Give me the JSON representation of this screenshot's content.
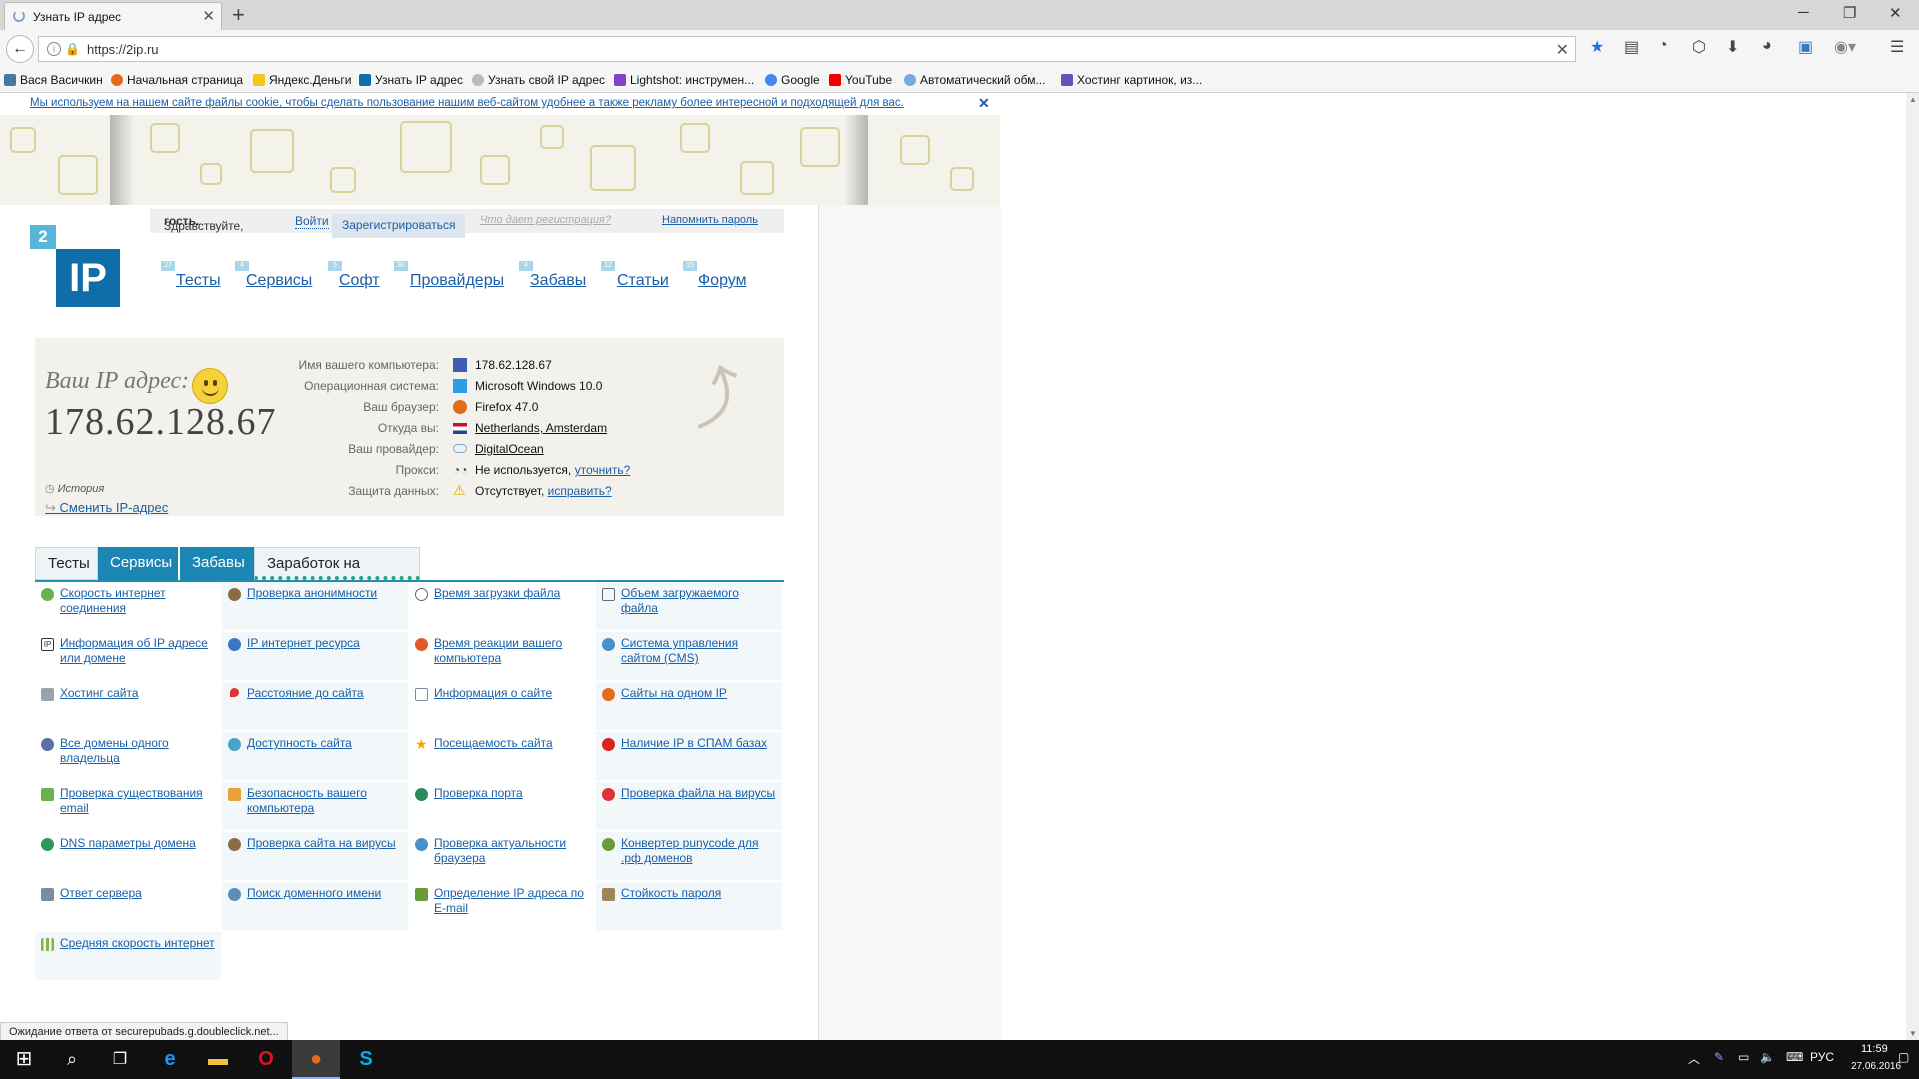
{
  "browser": {
    "tab_title": "Узнать IP адрес",
    "url": "https://2ip.ru",
    "bookmarks": [
      "Вася Васичкин",
      "Начальная страница",
      "Яндекс.Деньги",
      "Узнать IP адрес",
      "Узнать свой IP адрес",
      "Lightshot: инструмен...",
      "Google",
      "YouTube",
      "Автоматический обм...",
      "Хостинг картинок, из..."
    ],
    "status_text": "Ожидание ответа от securepubads.g.doubleclick.net..."
  },
  "cookie_notice": "Мы используем на нашем сайте файлы cookie, чтобы сделать пользование нашим веб-сайтом удобнее а также рекламу более интересной и подходящей для вас.",
  "login": {
    "greeting": "Здравствуйте, ",
    "user": "гость.",
    "login": "Войти",
    "register": "Зарегистрироваться",
    "why_register": "Что дает регистрация?",
    "forgot": "Напомнить пароль"
  },
  "logo": {
    "top": "2",
    "main": "IP"
  },
  "menu": [
    {
      "label": "Тесты",
      "badge": "27"
    },
    {
      "label": "Сервисы",
      "badge": "4"
    },
    {
      "label": "Софт",
      "badge": "5"
    },
    {
      "label": "Провайдеры",
      "badge": "3К"
    },
    {
      "label": "Забавы",
      "badge": "4"
    },
    {
      "label": "Статьи",
      "badge": "12"
    },
    {
      "label": "Форум",
      "badge": "15"
    }
  ],
  "ipinfo": {
    "title": "Ваш IP адрес:",
    "ip": "178.62.128.67",
    "history": "История",
    "change_ip": "Сменить IP-адрес",
    "rows": [
      {
        "label": "Имя вашего компьютера:",
        "value": "178.62.128.67",
        "link": false,
        "icon": "computer-icon",
        "color": "#3a5fb0"
      },
      {
        "label": "Операционная система:",
        "value": "Microsoft Windows 10.0",
        "link": false,
        "icon": "windows-icon",
        "color": "#2a9ce8"
      },
      {
        "label": "Ваш браузер:",
        "value": "Firefox 47.0",
        "link": false,
        "icon": "firefox-icon",
        "color": "#e36b1c"
      },
      {
        "label": "Откуда вы:",
        "value": "Netherlands, Amsterdam",
        "link": true,
        "icon": "flag-nl-icon",
        "color": "#c8102e"
      },
      {
        "label": "Ваш провайдер:",
        "value": "DigitalOcean",
        "link": true,
        "icon": "cloud-icon",
        "color": "#7aa9d8"
      },
      {
        "label": "Прокси:",
        "value": "Не используется, ",
        "link2": "уточнить?",
        "link": false,
        "icon": "glasses-icon",
        "color": "#444444"
      },
      {
        "label": "Защита данных:",
        "value": "Отсутствует, ",
        "link2": "исправить?",
        "link": false,
        "icon": "warning-icon",
        "color": "#f0c419"
      }
    ]
  },
  "tabs": [
    "Тесты",
    "Сервисы",
    "Забавы",
    "Заработок на трафике"
  ],
  "services": [
    [
      "Скорость интернет соединения",
      "Проверка анонимности",
      "Время загрузки файла",
      "Объем загружаемого файла"
    ],
    [
      "Информация об IP адресе или домене",
      "IP интернет ресурса",
      "Время реакции вашего компьютера",
      "Система управления сайтом (CMS)"
    ],
    [
      "Хостинг сайта",
      "Расстояние до сайта",
      "Информация о сайте",
      "Сайты на одном IP"
    ],
    [
      "Все домены одного владельца",
      "Доступность сайта",
      "Посещаемость сайта",
      "Наличие IP в СПАМ базах"
    ],
    [
      "Проверка существования email",
      "Безопасность вашего компьютера",
      "Проверка порта",
      "Проверка файла на вирусы"
    ],
    [
      "DNS параметры домена",
      "Проверка сайта на вирусы",
      "Проверка актуальности браузера",
      "Конвертер punycode для .рф доменов"
    ],
    [
      "Ответ сервера",
      "Поиск доменного имени",
      "Определение IP адреса по E-mail",
      "Стойкость пароля"
    ],
    [
      "Средняя скорость интернет"
    ]
  ],
  "colors": {
    "accent": "#1a5fa8",
    "tab_active": "#1b86b4",
    "logo": "#0f6da8"
  },
  "taskbar": {
    "lang": "РУС",
    "time": "11:59",
    "date": "27.06.2016"
  }
}
